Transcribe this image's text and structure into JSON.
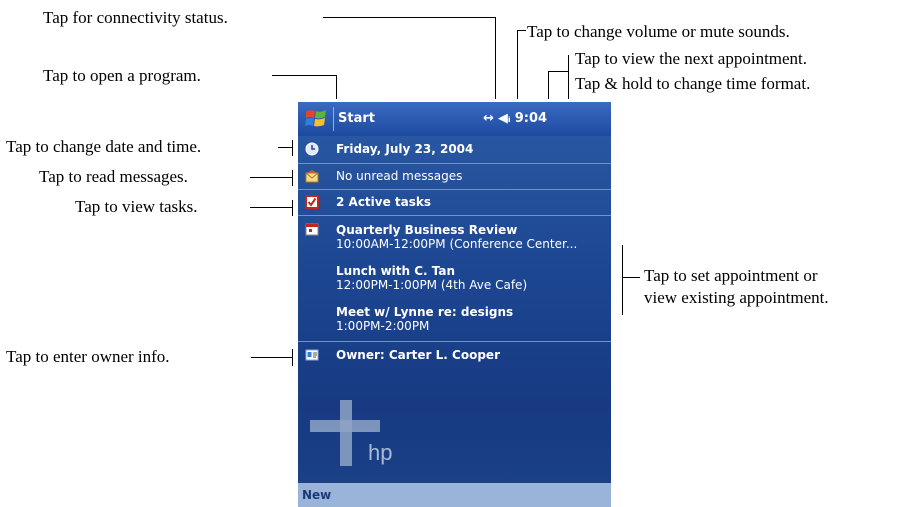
{
  "callouts": {
    "connectivity": "Tap for connectivity status.",
    "volume": "Tap to change volume or mute sounds.",
    "next_appt": "Tap to view the next appointment.",
    "time_format": "Tap & hold to change time format.",
    "open_program": "Tap to open a program.",
    "date_time": "Tap to change date and time.",
    "read_messages": "Tap to read messages.",
    "view_tasks": "Tap to view tasks.",
    "set_appt_1": "Tap to set appointment or",
    "set_appt_2": "view existing appointment.",
    "owner_info": "Tap to enter owner info."
  },
  "titlebar": {
    "start_label": "Start",
    "time": "9:04"
  },
  "today": {
    "date": "Friday, July 23, 2004",
    "messages": "No unread messages",
    "tasks": "2 Active tasks",
    "appointments": [
      {
        "title": "Quarterly Business Review",
        "detail": "10:00AM-12:00PM (Conference Center..."
      },
      {
        "title": "Lunch with C. Tan",
        "detail": "12:00PM-1:00PM (4th Ave Cafe)"
      },
      {
        "title": "Meet w/ Lynne re: designs",
        "detail": "1:00PM-2:00PM"
      }
    ],
    "owner": "Owner: Carter L. Cooper"
  },
  "logo_text": "hp",
  "menu": {
    "new_label": "New"
  }
}
